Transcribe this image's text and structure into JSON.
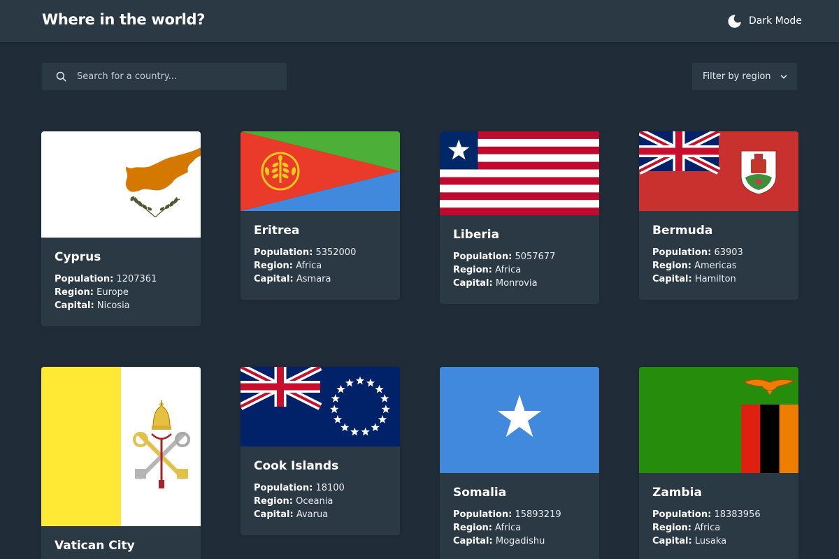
{
  "header": {
    "title": "Where in the world?",
    "mode_label": "Dark Mode",
    "mode_icon": "moon-icon"
  },
  "search": {
    "placeholder": "Search for a country...",
    "value": "",
    "icon": "search-icon"
  },
  "filter": {
    "label": "Filter by region",
    "icon": "chevron-down-icon"
  },
  "labels": {
    "population": "Population:",
    "region": "Region:",
    "capital": "Capital:"
  },
  "countries": [
    {
      "name": "Cyprus",
      "population": "1207361",
      "region": "Europe",
      "capital": "Nicosia",
      "flag": "cyprus-flag"
    },
    {
      "name": "Eritrea",
      "population": "5352000",
      "region": "Africa",
      "capital": "Asmara",
      "flag": "eritrea-flag"
    },
    {
      "name": "Liberia",
      "population": "5057677",
      "region": "Africa",
      "capital": "Monrovia",
      "flag": "liberia-flag"
    },
    {
      "name": "Bermuda",
      "population": "63903",
      "region": "Americas",
      "capital": "Hamilton",
      "flag": "bermuda-flag"
    },
    {
      "name": "Vatican City",
      "population": "",
      "region": "",
      "capital": "",
      "flag": "vatican-flag"
    },
    {
      "name": "Cook Islands",
      "population": "18100",
      "region": "Oceania",
      "capital": "Avarua",
      "flag": "cook-islands-flag"
    },
    {
      "name": "Somalia",
      "population": "15893219",
      "region": "Africa",
      "capital": "Mogadishu",
      "flag": "somalia-flag"
    },
    {
      "name": "Zambia",
      "population": "18383956",
      "region": "Africa",
      "capital": "Lusaka",
      "flag": "zambia-flag"
    }
  ],
  "colors": {
    "background": "#202c37",
    "element": "#2b3945",
    "text": "#ffffff"
  }
}
